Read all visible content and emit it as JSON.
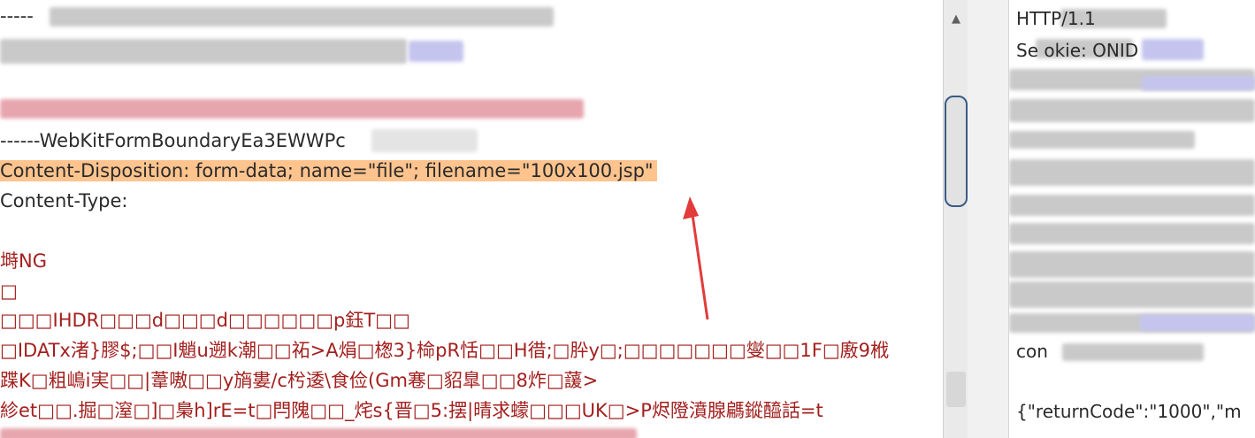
{
  "request": {
    "lines": [
      {
        "text": "-----",
        "color": "dark"
      },
      {
        "text": "------WebKitFormBoundaryEa3EWWPc",
        "color": "dark"
      },
      {
        "text": "Content-Disposition: form-data; name=\"file\"; filename=\"100x100.jsp\"",
        "color": "dark"
      },
      {
        "text": "Content-Type:",
        "color": "dark"
      },
      {
        "text": "塒NG",
        "color": "red"
      },
      {
        "text": "□",
        "color": "red"
      },
      {
        "text": "□□□IHDR□□□d□□□d□□□□□□p鈺T□□",
        "color": "red"
      },
      {
        "text": "□IDATx渚}膠$;□□I魈u遡k潮□□祏>A焆□楤3}椧pR恬□□H徣;□肸y□;□□□□□□□燮□□1F□廒9栰",
        "color": "red"
      },
      {
        "text": "蹀K□粗嶋i実□□|葦嗷□□y旓婁/c枍逶\\食俭(Gm寋□貂臯□□8炸□蘐>",
        "color": "red"
      },
      {
        "text": "紾et□□.掘□潌□]□梟h]rE=t□閂隗□□_烢s{晋□5:摆|晴求蠓□□□UK□>P烬隥濆腺騗鏦醯話=t",
        "color": "red"
      }
    ]
  },
  "response": {
    "lines": [
      "HTTP/1.1",
      "Se     okie:          ONID",
      "con",
      "{\"returnCode\":\"1000\",\"m"
    ]
  },
  "colors": {
    "highlight": "#ffc48e",
    "annotation_arrow": "#e23b3b",
    "body_red": "#a3201e"
  },
  "icons": {
    "scroll_up": "up-arrow-icon",
    "annotation": "red-arrow-icon"
  }
}
